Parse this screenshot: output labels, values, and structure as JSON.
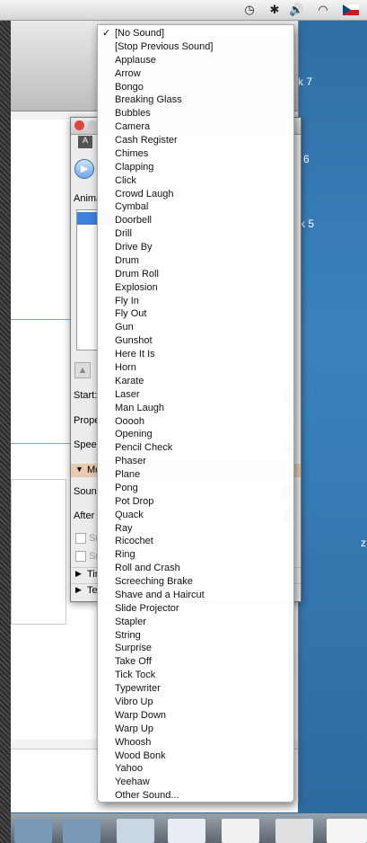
{
  "menubar": {
    "icons": [
      "time-machine-icon",
      "bluetooth-icon",
      "volume-icon",
      "wifi-icon",
      "flag-czech-icon"
    ]
  },
  "background_window": {
    "thumb_labels": [
      "k 7",
      "6",
      "k 5",
      "z"
    ]
  },
  "custom_animation_panel": {
    "labels": {
      "anim": "Anima",
      "start": "Start:",
      "prop": "Prope",
      "speed": "Speed",
      "mo": "Mo",
      "sound": "Sound",
      "after": "After",
      "sm1": "Sn",
      "sm2": "Sn",
      "timing": "Tin",
      "text": "Te"
    }
  },
  "sound_menu": {
    "selected": "[No Sound]",
    "items": [
      "[No Sound]",
      "[Stop Previous Sound]",
      "Applause",
      "Arrow",
      "Bongo",
      "Breaking Glass",
      "Bubbles",
      "Camera",
      "Cash Register",
      "Chimes",
      "Clapping",
      "Click",
      "Crowd Laugh",
      "Cymbal",
      "Doorbell",
      "Drill",
      "Drive By",
      "Drum",
      "Drum Roll",
      "Explosion",
      "Fly In",
      "Fly Out",
      "Gun",
      "Gunshot",
      "Here It Is",
      "Horn",
      "Karate",
      "Laser",
      "Man Laugh",
      "Ooooh",
      "Opening",
      "Pencil Check",
      "Phaser",
      "Plane",
      "Pong",
      "Pot Drop",
      "Quack",
      "Ray",
      "Ricochet",
      "Ring",
      "Roll and Crash",
      "Screeching Brake",
      "Shave and a Haircut",
      "Slide Projector",
      "Stapler",
      "String",
      "Surprise",
      "Take Off",
      "Tick Tock",
      "Typewriter",
      "Vibro Up",
      "Warp Down",
      "Warp Up",
      "Whoosh",
      "Wood Bonk",
      "Yahoo",
      "Yeehaw",
      "Other Sound..."
    ]
  },
  "colors": {
    "menu_bg": "#ffffff",
    "accent": "#3d80df",
    "desktop": "#2f6ea5"
  }
}
